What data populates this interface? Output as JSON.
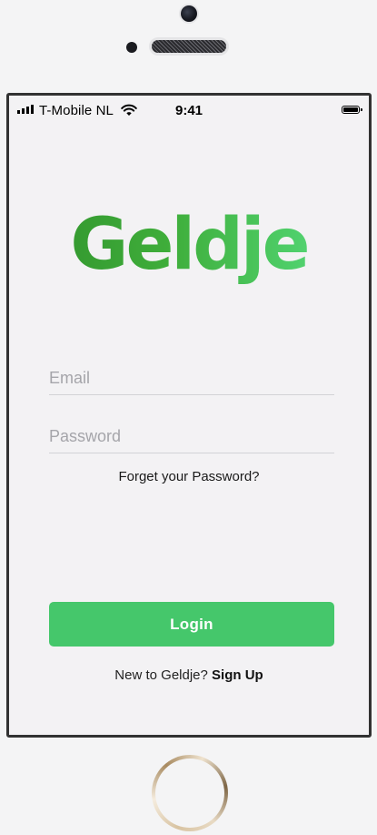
{
  "status_bar": {
    "carrier": "T-Mobile NL",
    "time": "9:41"
  },
  "logo": {
    "text": "Geldje"
  },
  "form": {
    "email_placeholder": "Email",
    "password_placeholder": "Password",
    "forgot_label": "Forget your Password?",
    "login_label": "Login",
    "signup_prompt": "New to Geldje?",
    "signup_link": "Sign Up"
  },
  "colors": {
    "accent": "#45c76b",
    "logo_gradient_start": "#2f8f2a",
    "logo_gradient_end": "#6fe08f"
  },
  "icons": {
    "signal": "cellular-signal-icon",
    "wifi": "wifi-icon",
    "battery": "battery-icon"
  }
}
